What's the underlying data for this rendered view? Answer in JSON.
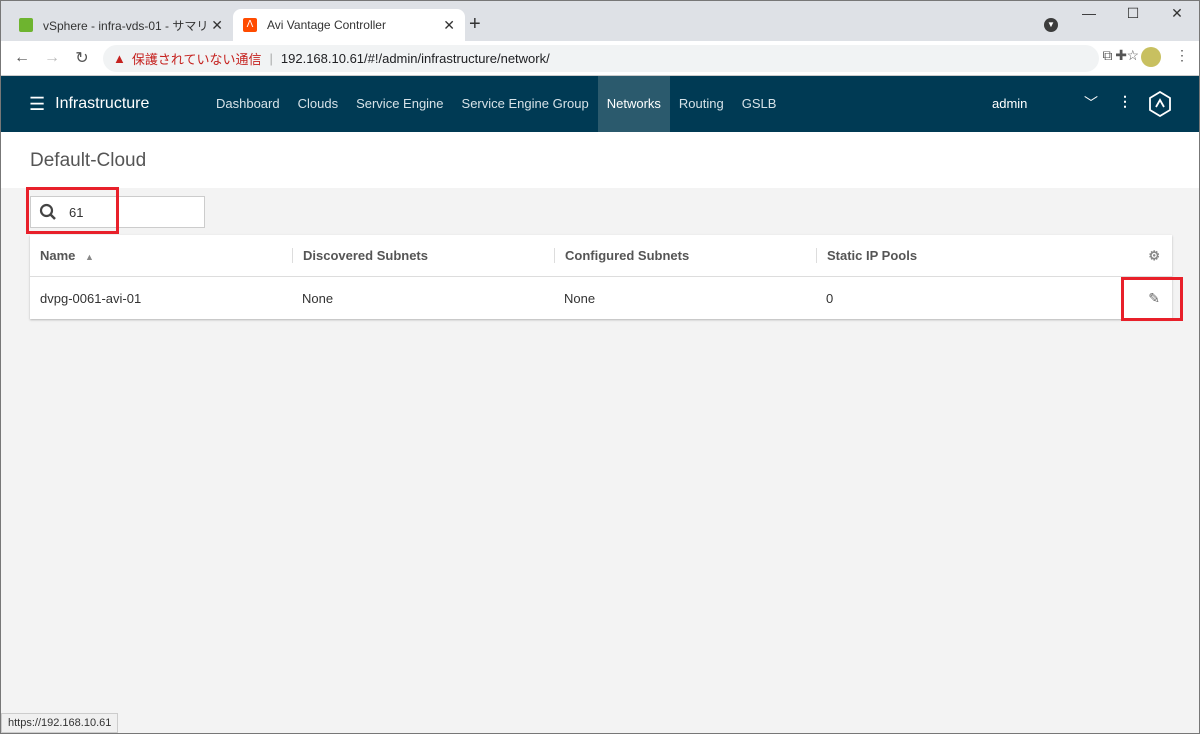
{
  "browser": {
    "tabs": [
      {
        "title": "vSphere - infra-vds-01 - サマリ",
        "icon": "vsphere-icon",
        "color": "#6eb42f"
      },
      {
        "title": "Avi Vantage Controller",
        "icon": "avi-icon",
        "color": "#ff4b00"
      }
    ],
    "security_label": "保護されていない通信",
    "url_host": "192.168.10.61",
    "url_path": "/#!/admin/infrastructure/network/",
    "status_url": "https://192.168.10.61"
  },
  "app": {
    "section_title": "Infrastructure",
    "nav": [
      "Dashboard",
      "Clouds",
      "Service Engine",
      "Service Engine Group",
      "Networks",
      "Routing",
      "GSLB"
    ],
    "active_nav": "Networks",
    "user": "admin",
    "brand_color": "#003a54"
  },
  "page": {
    "title": "Default-Cloud",
    "search_value": "61",
    "table": {
      "columns": [
        "Name",
        "Discovered Subnets",
        "Configured Subnets",
        "Static IP Pools"
      ],
      "sort": "Name ascending",
      "rows": [
        [
          "dvpg-0061-avi-01",
          "None",
          "None",
          "0"
        ]
      ]
    }
  }
}
